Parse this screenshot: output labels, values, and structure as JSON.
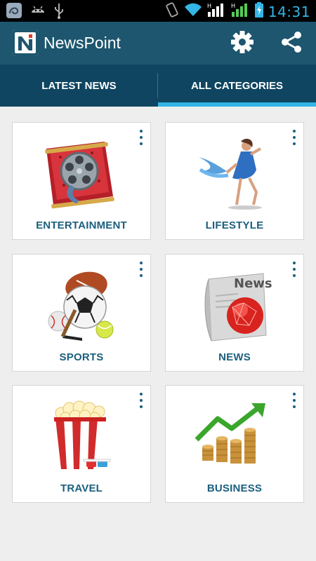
{
  "status_bar": {
    "time": "14:31",
    "icons": [
      "app-notification-icon",
      "android-debug-icon",
      "usb-icon",
      "vibrate-icon",
      "wifi-icon",
      "signal-icon",
      "signal-2-icon",
      "battery-charging-icon"
    ]
  },
  "app_bar": {
    "title": "NewsPoint",
    "logo_letter": "N",
    "actions": [
      "settings-icon",
      "share-icon"
    ]
  },
  "tabs": [
    {
      "label": "LATEST NEWS",
      "selected": false
    },
    {
      "label": "ALL CATEGORIES",
      "selected": true
    }
  ],
  "categories": [
    {
      "label": "ENTERTAINMENT",
      "icon": "film-reel-icon"
    },
    {
      "label": "LIFESTYLE",
      "icon": "dancer-icon"
    },
    {
      "label": "SPORTS",
      "icon": "sports-balls-icon"
    },
    {
      "label": "NEWS",
      "icon": "newspaper-globe-icon"
    },
    {
      "label": "TRAVEL",
      "icon": "popcorn-icon"
    },
    {
      "label": "BUSINESS",
      "icon": "coins-growth-icon"
    }
  ],
  "news_art_text": "News",
  "colors": {
    "app_bar": "#1d566e",
    "tab_bar": "#0f4560",
    "accent": "#33b5e5",
    "category_label": "#1b5f7e",
    "background": "#eeeeee"
  }
}
